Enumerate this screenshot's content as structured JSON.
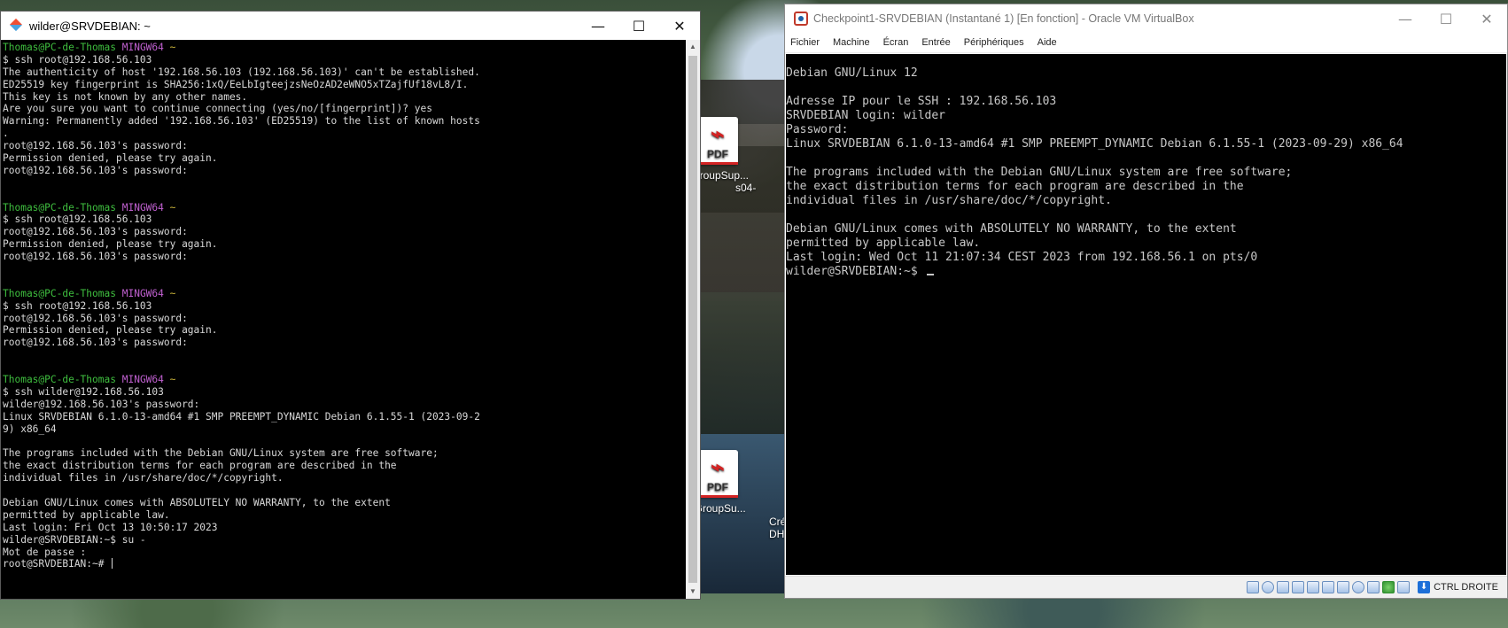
{
  "desktop": {
    "icons": [
      {
        "label": "llGroupSup...",
        "label2": "s04-"
      },
      {
        "label": "llGroupSu...",
        "label2": "Cré\nDH("
      }
    ],
    "pdf_text": "PDF"
  },
  "mintty": {
    "title": "wilder@SRVDEBIAN: ~",
    "controls": {
      "minimize": "—",
      "maximize": "☐",
      "close": "✕"
    },
    "prompt": {
      "user": "Thomas@PC-de-Thomas",
      "env": "MINGW64",
      "path": "~"
    },
    "lines": [
      {
        "t": "prompt"
      },
      {
        "t": "text",
        "v": "$ ssh root@192.168.56.103"
      },
      {
        "t": "text",
        "v": "The authenticity of host '192.168.56.103 (192.168.56.103)' can't be established."
      },
      {
        "t": "text",
        "v": "ED25519 key fingerprint is SHA256:1xQ/EeLbIgteejzsNeOzAD2eWNO5xTZajfUf18vL8/I."
      },
      {
        "t": "text",
        "v": "This key is not known by any other names."
      },
      {
        "t": "text",
        "v": "Are you sure you want to continue connecting (yes/no/[fingerprint])? yes"
      },
      {
        "t": "text",
        "v": "Warning: Permanently added '192.168.56.103' (ED25519) to the list of known hosts"
      },
      {
        "t": "text",
        "v": "."
      },
      {
        "t": "text",
        "v": "root@192.168.56.103's password:"
      },
      {
        "t": "text",
        "v": "Permission denied, please try again."
      },
      {
        "t": "text",
        "v": "root@192.168.56.103's password:"
      },
      {
        "t": "text",
        "v": ""
      },
      {
        "t": "text",
        "v": ""
      },
      {
        "t": "prompt"
      },
      {
        "t": "text",
        "v": "$ ssh root@192.168.56.103"
      },
      {
        "t": "text",
        "v": "root@192.168.56.103's password:"
      },
      {
        "t": "text",
        "v": "Permission denied, please try again."
      },
      {
        "t": "text",
        "v": "root@192.168.56.103's password:"
      },
      {
        "t": "text",
        "v": ""
      },
      {
        "t": "text",
        "v": ""
      },
      {
        "t": "prompt"
      },
      {
        "t": "text",
        "v": "$ ssh root@192.168.56.103"
      },
      {
        "t": "text",
        "v": "root@192.168.56.103's password:"
      },
      {
        "t": "text",
        "v": "Permission denied, please try again."
      },
      {
        "t": "text",
        "v": "root@192.168.56.103's password:"
      },
      {
        "t": "text",
        "v": ""
      },
      {
        "t": "text",
        "v": ""
      },
      {
        "t": "prompt"
      },
      {
        "t": "text",
        "v": "$ ssh wilder@192.168.56.103"
      },
      {
        "t": "text",
        "v": "wilder@192.168.56.103's password:"
      },
      {
        "t": "text",
        "v": "Linux SRVDEBIAN 6.1.0-13-amd64 #1 SMP PREEMPT_DYNAMIC Debian 6.1.55-1 (2023-09-2"
      },
      {
        "t": "text",
        "v": "9) x86_64"
      },
      {
        "t": "text",
        "v": ""
      },
      {
        "t": "text",
        "v": "The programs included with the Debian GNU/Linux system are free software;"
      },
      {
        "t": "text",
        "v": "the exact distribution terms for each program are described in the"
      },
      {
        "t": "text",
        "v": "individual files in /usr/share/doc/*/copyright."
      },
      {
        "t": "text",
        "v": ""
      },
      {
        "t": "text",
        "v": "Debian GNU/Linux comes with ABSOLUTELY NO WARRANTY, to the extent"
      },
      {
        "t": "text",
        "v": "permitted by applicable law."
      },
      {
        "t": "text",
        "v": "Last login: Fri Oct 13 10:50:17 2023"
      },
      {
        "t": "text",
        "v": "wilder@SRVDEBIAN:~$ su -"
      },
      {
        "t": "text",
        "v": "Mot de passe :"
      },
      {
        "t": "cursor",
        "v": "root@SRVDEBIAN:~# "
      }
    ]
  },
  "vbox": {
    "title": "Checkpoint1-SRVDEBIAN (Instantané 1) [En fonction] - Oracle VM VirtualBox",
    "controls": {
      "minimize": "—",
      "maximize": "☐",
      "close": "✕"
    },
    "menu": [
      "Fichier",
      "Machine",
      "Écran",
      "Entrée",
      "Périphériques",
      "Aide"
    ],
    "console": [
      "Debian GNU/Linux 12",
      "",
      "Adresse IP pour le SSH : 192.168.56.103",
      "SRVDEBIAN login: wilder",
      "Password:",
      "Linux SRVDEBIAN 6.1.0-13-amd64 #1 SMP PREEMPT_DYNAMIC Debian 6.1.55-1 (2023-09-29) x86_64",
      "",
      "The programs included with the Debian GNU/Linux system are free software;",
      "the exact distribution terms for each program are described in the",
      "individual files in /usr/share/doc/*/copyright.",
      "",
      "Debian GNU/Linux comes with ABSOLUTELY NO WARRANTY, to the extent",
      "permitted by applicable law.",
      "Last login: Wed Oct 11 21:07:34 CEST 2023 from 192.168.56.1 on pts/0"
    ],
    "console_prompt": "wilder@SRVDEBIAN:~$ ",
    "status_icons": [
      "hard-disk",
      "optical-drive",
      "audio",
      "network",
      "usb",
      "shared-folders",
      "display",
      "video-capture",
      "mouse-integration",
      "cpu-activity",
      "keyboard"
    ],
    "host_key": "CTRL DROITE",
    "host_key_arrow": "⬇"
  }
}
